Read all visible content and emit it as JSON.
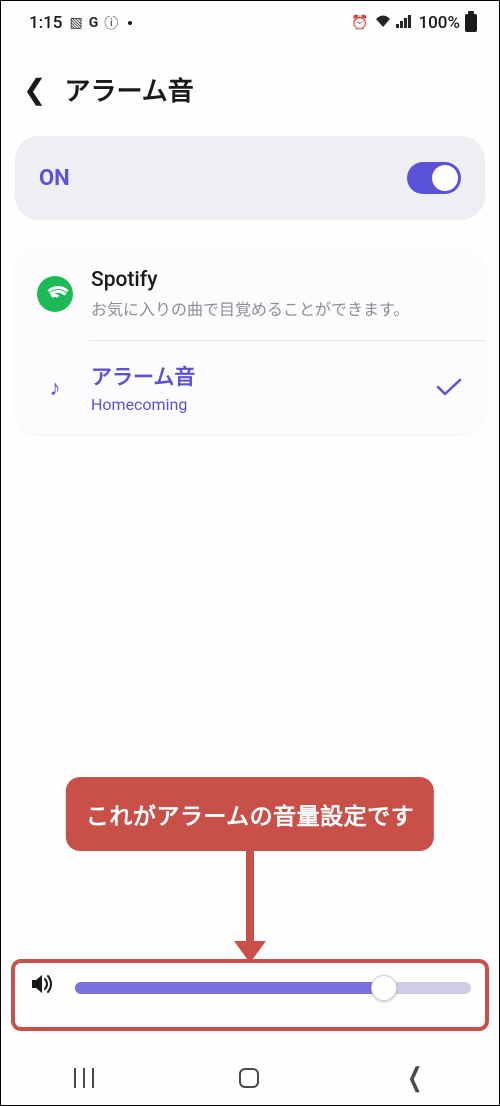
{
  "status": {
    "time": "1:15",
    "battery": "100%"
  },
  "header": {
    "title": "アラーム音"
  },
  "on_toggle": {
    "label": "ON",
    "enabled": true
  },
  "options": {
    "spotify": {
      "title": "Spotify",
      "subtitle": "お気に入りの曲で目覚めることができます。"
    },
    "alarm_sound": {
      "title": "アラーム音",
      "subtitle": "Homecoming",
      "selected": true
    }
  },
  "annotation": {
    "text": "これがアラームの音量設定です"
  },
  "volume": {
    "percent": 78
  }
}
